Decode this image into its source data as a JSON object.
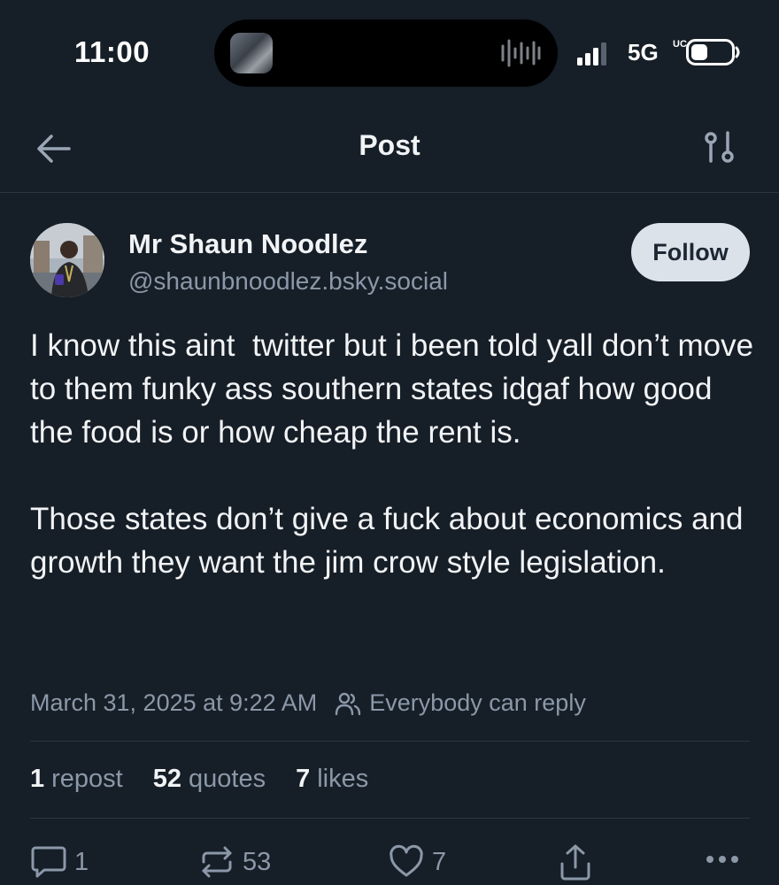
{
  "status_bar": {
    "time": "11:00",
    "network": "5G",
    "network_sup": "UC",
    "icons": [
      "dynamic-island-thumbnail",
      "audio-waveform-icon",
      "signal-bars-icon",
      "battery-icon"
    ]
  },
  "header": {
    "title": "Post",
    "back_icon": "back-arrow-icon",
    "filter_icon": "filter-sliders-icon"
  },
  "post": {
    "author_name": "Mr Shaun Noodlez",
    "author_handle": "@shaunbnoodlez.bsky.social",
    "follow_label": "Follow",
    "text": [
      "I know this aint  twitter but i been told yall don’t move to them funky ass southern states idgaf how good the food is or how cheap the rent is.",
      "Those states don’t give a fuck about economics and growth they want the jim crow style legislation."
    ],
    "timestamp": "March 31, 2025 at 9:22 AM",
    "reply_setting": "Everybody can reply"
  },
  "stats": {
    "reposts_count": "1",
    "reposts_label": "repost",
    "quotes_count": "52",
    "quotes_label": "quotes",
    "likes_count": "7",
    "likes_label": "likes"
  },
  "actions": {
    "reply_count": "1",
    "repost_count": "53",
    "like_count": "7",
    "icons": [
      "reply-icon",
      "repost-icon",
      "like-icon",
      "share-icon",
      "more-icon"
    ]
  },
  "colors": {
    "background": "#161e27",
    "primary_text": "#f1f3f5",
    "secondary_text": "#8b98a8",
    "divider": "#2b3542",
    "follow_button": "#dce2ea"
  }
}
